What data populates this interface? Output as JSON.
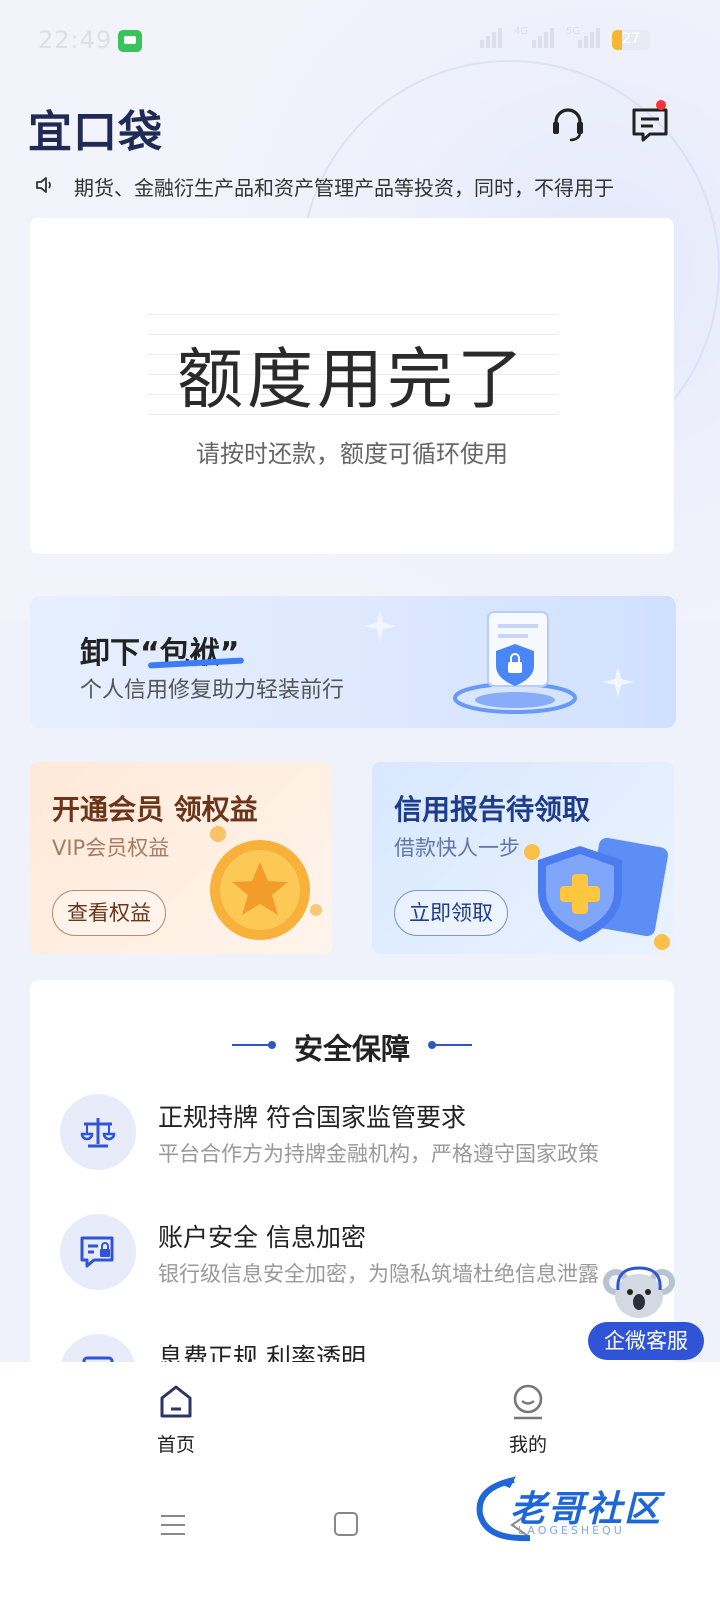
{
  "status_bar": {
    "time": "22:49",
    "battery_percent": 27,
    "battery_text": "27",
    "net_labels": [
      "4G",
      "5G"
    ]
  },
  "header": {
    "logo_text": "宜口袋"
  },
  "notice": {
    "text": "期货、金融衍生产品和资产管理产品等投资，同时，不得用于"
  },
  "quota_card": {
    "title": "额度用完了",
    "subtitle": "请按时还款，额度可循环使用"
  },
  "banner": {
    "title_prefix": "卸下",
    "title_quote": "“包袱”",
    "subtitle": "个人信用修复助力轻装前行"
  },
  "promos": [
    {
      "title": "开通会员 领权益",
      "subtitle": "VIP会员权益",
      "button": "查看权益"
    },
    {
      "title": "信用报告待领取",
      "subtitle": "借款快人一步",
      "button": "立即领取"
    }
  ],
  "security": {
    "heading": "安全保障",
    "items": [
      {
        "title": "正规持牌 符合国家监管要求",
        "desc": "平台合作方为持牌金融机构，严格遵守国家政策"
      },
      {
        "title": "账户安全 信息加密",
        "desc": "银行级信息安全加密，为隐私筑墙杜绝信息泄露"
      },
      {
        "title": "息费正规 利率透明",
        "desc": ""
      }
    ]
  },
  "float_support": {
    "label": "企微客服"
  },
  "bottom_nav": {
    "home": "首页",
    "mine": "我的"
  },
  "watermark": {
    "text": "老哥社区",
    "sub": "LAOGESHEQU"
  },
  "colors": {
    "accent": "#2f54d6",
    "vip": "#6b3519",
    "credit": "#1e3c8c"
  }
}
